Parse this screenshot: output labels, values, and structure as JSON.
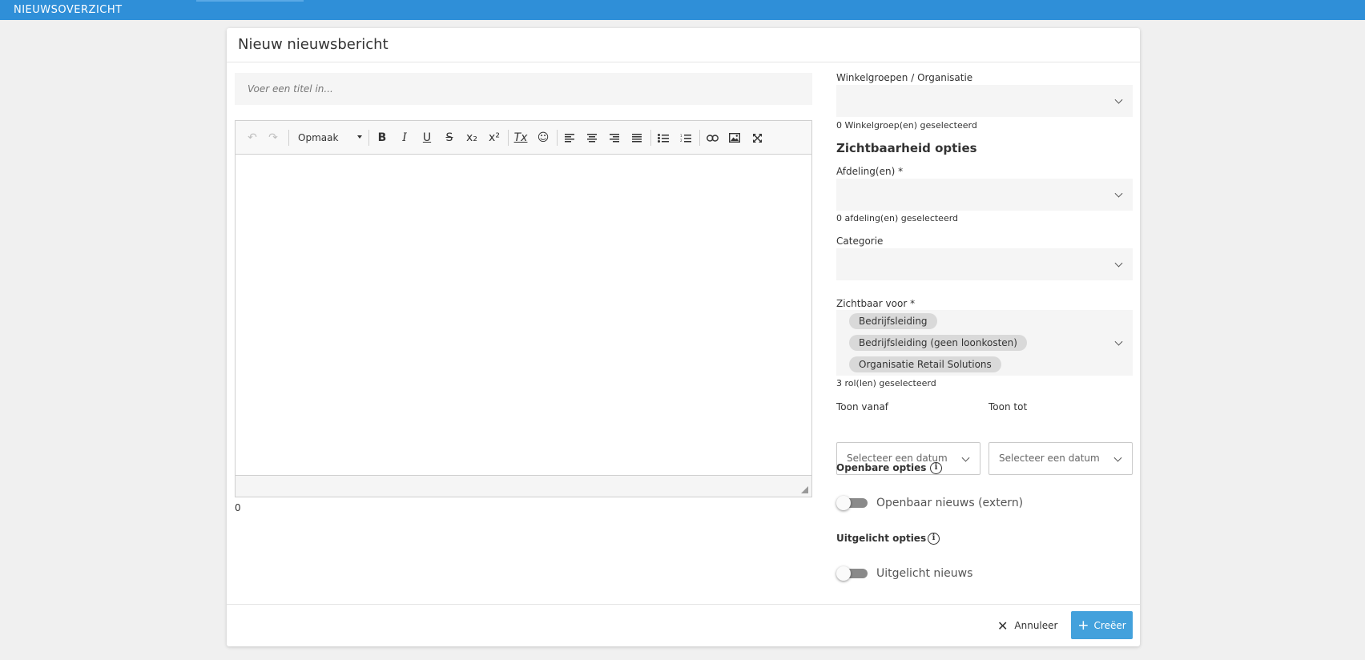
{
  "topbar": {
    "label": "NIEUWSOVERZICHT"
  },
  "modal": {
    "title": "Nieuw nieuwsbericht",
    "title_placeholder": "Voer een titel in...",
    "editor": {
      "format_label": "Opmaak",
      "char_count": "0",
      "tools": [
        "undo-icon",
        "redo-icon",
        "bold-icon",
        "italic-icon",
        "underline-icon",
        "strikethrough-icon",
        "subscript-icon",
        "superscript-icon",
        "remove-format-icon",
        "emoji-icon",
        "align-left-icon",
        "align-center-icon",
        "align-right-icon",
        "align-justify-icon",
        "bulleted-list-icon",
        "numbered-list-icon",
        "link-icon",
        "image-icon",
        "fullscreen-icon"
      ]
    },
    "winkelgroepen": {
      "label": "Winkelgroepen / Organisatie",
      "helper": "0 Winkelgroep(en) geselecteerd"
    },
    "visibility_title": "Zichtbaarheid opties",
    "afdeling": {
      "label": "Afdeling(en) *",
      "helper": "0 afdeling(en) geselecteerd"
    },
    "categorie": {
      "label": "Categorie"
    },
    "zichtbaar_voor": {
      "label": "Zichtbaar voor *",
      "chips": [
        "Bedrijfsleiding",
        "Bedrijfsleiding (geen loonkosten)",
        "Organisatie Retail Solutions"
      ],
      "helper": "3 rol(len) geselecteerd"
    },
    "toon_vanaf": {
      "label": "Toon vanaf",
      "placeholder": "Selecteer een datum"
    },
    "toon_tot": {
      "label": "Toon tot",
      "placeholder": "Selecteer een datum"
    },
    "openbare": {
      "title": "Openbare opties",
      "toggle_label": "Openbaar nieuws (extern)",
      "on": false
    },
    "uitgelicht": {
      "title": "Uitgelicht opties",
      "toggle_label": "Uitgelicht nieuws",
      "on": false
    },
    "footer": {
      "cancel_label": "Annuleer",
      "create_label": "Creëer"
    }
  },
  "colors": {
    "topbar": "#2f8fd8",
    "primary_button": "#43a1dc",
    "field_bg": "#f5f5f5",
    "chip_bg": "#d9d9d9"
  }
}
